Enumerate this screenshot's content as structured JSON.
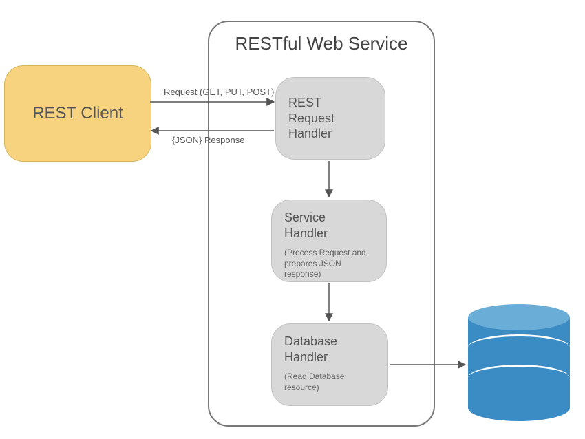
{
  "client": {
    "label": "REST Client"
  },
  "service": {
    "title": "RESTful Web Service"
  },
  "nodes": {
    "request_handler": {
      "title_l1": "REST",
      "title_l2": "Request",
      "title_l3": "Handler"
    },
    "service_handler": {
      "title_l1": "Service",
      "title_l2": "Handler",
      "subtitle": "(Process Request and prepares JSON response)"
    },
    "database_handler": {
      "title_l1": "Database",
      "title_l2": "Handler",
      "subtitle": "(Read Database resource)"
    }
  },
  "arrows": {
    "request_label": "Request (GET, PUT, POST)",
    "response_label": "{JSON} Response"
  },
  "database": {
    "name": "database-cylinder"
  }
}
